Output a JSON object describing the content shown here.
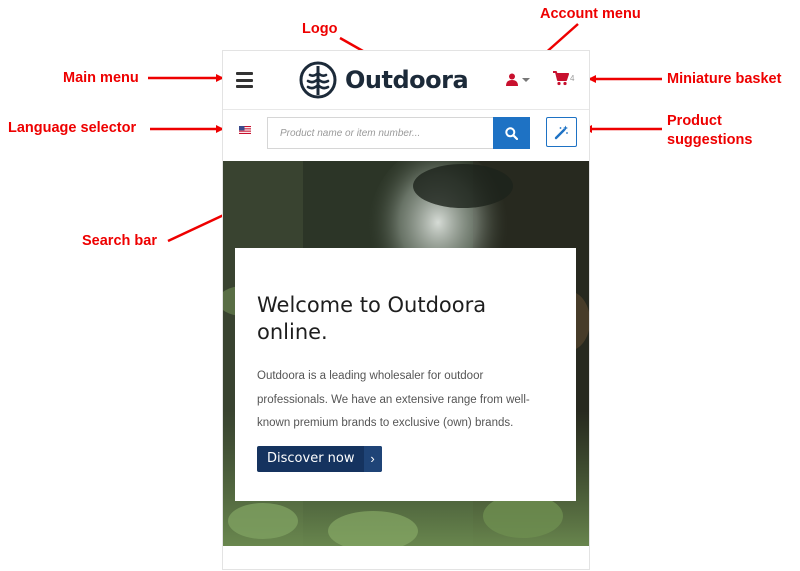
{
  "annotations": {
    "logo": "Logo",
    "account_menu": "Account menu",
    "main_menu": "Main menu",
    "miniature_basket": "Miniature basket",
    "language_selector": "Language selector",
    "product_suggestions_line1": "Product",
    "product_suggestions_line2": "suggestions",
    "search_bar": "Search bar"
  },
  "annotation_color": "#ee0000",
  "header": {
    "logo_text": "Outdoora",
    "hamburger_icon": "hamburger-menu-icon",
    "account_icon": "user-icon",
    "basket_icon": "shopping-cart-icon",
    "basket_count": "4",
    "accent_color": "#c8102e"
  },
  "search": {
    "placeholder": "Product name or item number...",
    "value": "",
    "language_flag": "us-flag-icon",
    "search_icon": "search-icon",
    "suggestions_icon": "magic-wand-icon",
    "button_color": "#1e72c4"
  },
  "hero": {
    "title": "Welcome to Outdoora online.",
    "body": "Outdoora is a leading wholesaler for outdoor professionals. We have an extensive range from well-known premium brands to exclusive (own) brands.",
    "cta_label": "Discover now",
    "cta_chevron": "›",
    "cta_color": "#15335f"
  }
}
